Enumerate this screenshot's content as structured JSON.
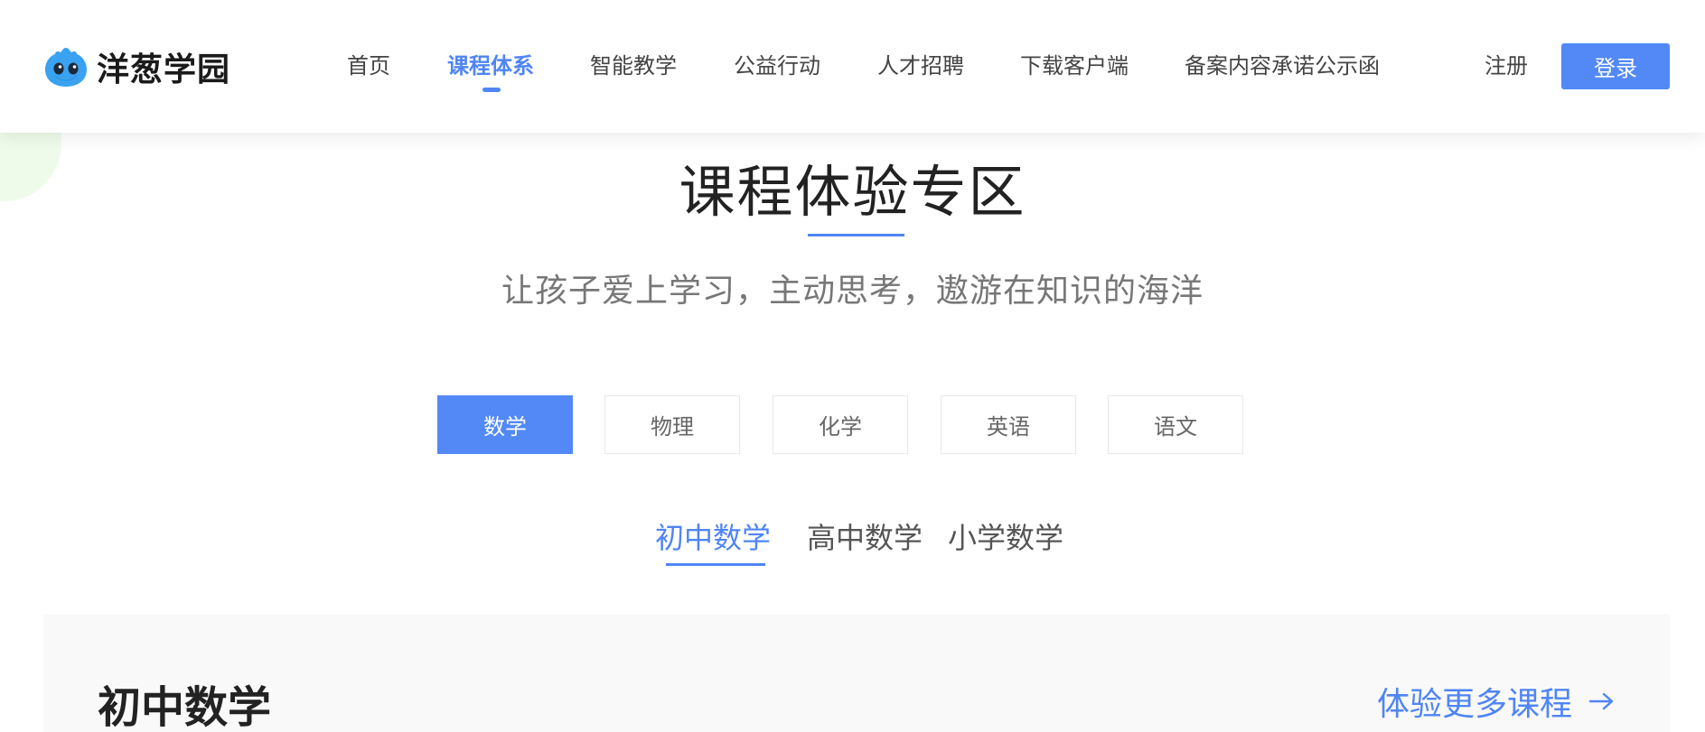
{
  "header": {
    "logo_text": "洋葱学园",
    "nav": [
      {
        "label": "首页",
        "active": false
      },
      {
        "label": "课程体系",
        "active": true
      },
      {
        "label": "智能教学",
        "active": false
      },
      {
        "label": "公益行动",
        "active": false
      },
      {
        "label": "人才招聘",
        "active": false
      },
      {
        "label": "下载客户端",
        "active": false
      },
      {
        "label": "备案内容承诺公示函",
        "active": false
      }
    ],
    "register_label": "注册",
    "login_label": "登录"
  },
  "section": {
    "title": "课程体验专区",
    "subtitle": "让孩子爱上学习，主动思考，遨游在知识的海洋"
  },
  "subject_tabs": [
    {
      "label": "数学",
      "active": true
    },
    {
      "label": "物理",
      "active": false
    },
    {
      "label": "化学",
      "active": false
    },
    {
      "label": "英语",
      "active": false
    },
    {
      "label": "语文",
      "active": false
    }
  ],
  "level_tabs": [
    {
      "label": "初中数学",
      "active": true
    },
    {
      "label": "高中数学",
      "active": false
    },
    {
      "label": "小学数学",
      "active": false
    }
  ],
  "panel": {
    "title": "初中数学",
    "more_label": "体验更多课程",
    "more_icon": "arrow-right-icon"
  },
  "colors": {
    "accent": "#4f85f5",
    "button": "#5289f7",
    "panel_bg": "#f9f9f9",
    "mascot": "#3aa2f0"
  }
}
